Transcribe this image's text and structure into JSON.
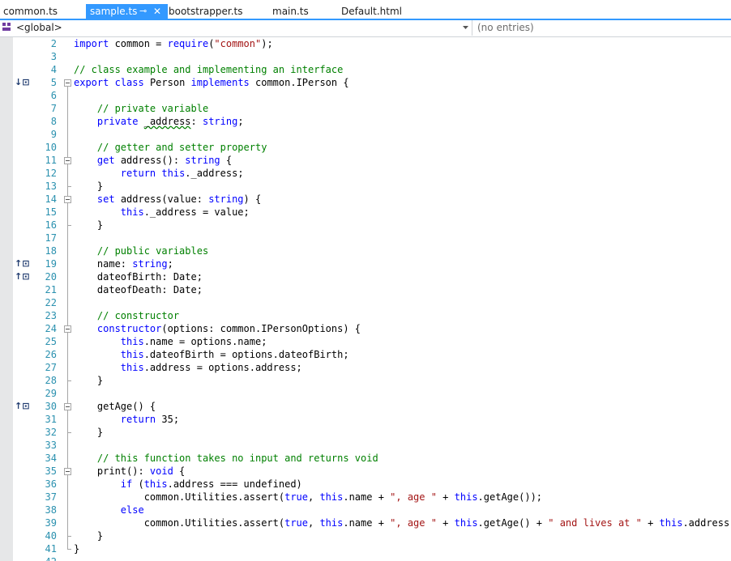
{
  "tabs": [
    {
      "label": "common.ts",
      "active": false
    },
    {
      "label": "sample.ts",
      "active": true,
      "pin": "⊸",
      "close": "✕"
    },
    {
      "label": "bootstrapper.ts",
      "active": false
    },
    {
      "label": "main.ts",
      "active": false
    },
    {
      "label": "Default.html",
      "active": false
    }
  ],
  "nav": {
    "scope": "<global>",
    "members": "(no entries)"
  },
  "colors": {
    "accent": "#3399ff",
    "keyword": "#0000ff",
    "comment": "#008000",
    "string": "#a31515",
    "linenumber": "#2b91af"
  },
  "glyphs": {
    "implements_down": "↓⊡",
    "implements_up": "↑⊡"
  },
  "lines": [
    {
      "n": "2",
      "t": [
        [
          "k",
          "import"
        ],
        [
          "p",
          " common = "
        ],
        [
          "k",
          "require"
        ],
        [
          "p",
          "("
        ],
        [
          "s",
          "\"common\""
        ],
        [
          "p",
          ");"
        ]
      ]
    },
    {
      "n": "3",
      "t": []
    },
    {
      "n": "4",
      "t": [
        [
          "c",
          "// class example and implementing an interface"
        ]
      ]
    },
    {
      "n": "5",
      "t": [
        [
          "k",
          "export"
        ],
        [
          "p",
          " "
        ],
        [
          "k",
          "class"
        ],
        [
          "p",
          " Person "
        ],
        [
          "k",
          "implements"
        ],
        [
          "p",
          " common.IPerson {"
        ]
      ]
    },
    {
      "n": "6",
      "t": []
    },
    {
      "n": "7",
      "t": [
        [
          "p",
          "    "
        ],
        [
          "c",
          "// private variable"
        ]
      ]
    },
    {
      "n": "8",
      "t": [
        [
          "p",
          "    "
        ],
        [
          "k",
          "private"
        ],
        [
          "p",
          " "
        ],
        [
          "sq",
          "_address"
        ],
        [
          "p",
          ": "
        ],
        [
          "k",
          "string"
        ],
        [
          "p",
          ";"
        ]
      ]
    },
    {
      "n": "9",
      "t": []
    },
    {
      "n": "10",
      "t": [
        [
          "p",
          "    "
        ],
        [
          "c",
          "// getter and setter property"
        ]
      ]
    },
    {
      "n": "11",
      "t": [
        [
          "p",
          "    "
        ],
        [
          "k",
          "get"
        ],
        [
          "p",
          " address(): "
        ],
        [
          "k",
          "string"
        ],
        [
          "p",
          " {"
        ]
      ]
    },
    {
      "n": "12",
      "t": [
        [
          "p",
          "        "
        ],
        [
          "k",
          "return"
        ],
        [
          "p",
          " "
        ],
        [
          "k",
          "this"
        ],
        [
          "p",
          "._address;"
        ]
      ]
    },
    {
      "n": "13",
      "t": [
        [
          "p",
          "    }"
        ]
      ]
    },
    {
      "n": "14",
      "t": [
        [
          "p",
          "    "
        ],
        [
          "k",
          "set"
        ],
        [
          "p",
          " address(value: "
        ],
        [
          "k",
          "string"
        ],
        [
          "p",
          ") {"
        ]
      ]
    },
    {
      "n": "15",
      "t": [
        [
          "p",
          "        "
        ],
        [
          "k",
          "this"
        ],
        [
          "p",
          "._address = value;"
        ]
      ]
    },
    {
      "n": "16",
      "t": [
        [
          "p",
          "    }"
        ]
      ]
    },
    {
      "n": "17",
      "t": []
    },
    {
      "n": "18",
      "t": [
        [
          "p",
          "    "
        ],
        [
          "c",
          "// public variables"
        ]
      ]
    },
    {
      "n": "19",
      "t": [
        [
          "p",
          "    name: "
        ],
        [
          "k",
          "string"
        ],
        [
          "p",
          ";"
        ]
      ]
    },
    {
      "n": "20",
      "t": [
        [
          "p",
          "    dateofBirth: Date;"
        ]
      ]
    },
    {
      "n": "21",
      "t": [
        [
          "p",
          "    dateofDeath: Date;"
        ]
      ]
    },
    {
      "n": "22",
      "t": []
    },
    {
      "n": "23",
      "t": [
        [
          "p",
          "    "
        ],
        [
          "c",
          "// constructor"
        ]
      ]
    },
    {
      "n": "24",
      "t": [
        [
          "p",
          "    "
        ],
        [
          "k",
          "constructor"
        ],
        [
          "p",
          "(options: common.IPersonOptions) {"
        ]
      ]
    },
    {
      "n": "25",
      "t": [
        [
          "p",
          "        "
        ],
        [
          "k",
          "this"
        ],
        [
          "p",
          ".name = options.name;"
        ]
      ]
    },
    {
      "n": "26",
      "t": [
        [
          "p",
          "        "
        ],
        [
          "k",
          "this"
        ],
        [
          "p",
          ".dateofBirth = options.dateofBirth;"
        ]
      ]
    },
    {
      "n": "27",
      "t": [
        [
          "p",
          "        "
        ],
        [
          "k",
          "this"
        ],
        [
          "p",
          ".address = options.address;"
        ]
      ]
    },
    {
      "n": "28",
      "t": [
        [
          "p",
          "    }"
        ]
      ]
    },
    {
      "n": "29",
      "t": []
    },
    {
      "n": "30",
      "t": [
        [
          "p",
          "    getAge() {"
        ]
      ]
    },
    {
      "n": "31",
      "t": [
        [
          "p",
          "        "
        ],
        [
          "k",
          "return"
        ],
        [
          "p",
          " 35;"
        ]
      ]
    },
    {
      "n": "32",
      "t": [
        [
          "p",
          "    }"
        ]
      ]
    },
    {
      "n": "33",
      "t": []
    },
    {
      "n": "34",
      "t": [
        [
          "p",
          "    "
        ],
        [
          "c",
          "// this function takes no input and returns void"
        ]
      ]
    },
    {
      "n": "35",
      "t": [
        [
          "p",
          "    print(): "
        ],
        [
          "k",
          "void"
        ],
        [
          "p",
          " {"
        ]
      ]
    },
    {
      "n": "36",
      "t": [
        [
          "p",
          "        "
        ],
        [
          "k",
          "if"
        ],
        [
          "p",
          " ("
        ],
        [
          "k",
          "this"
        ],
        [
          "p",
          ".address === undefined)"
        ]
      ]
    },
    {
      "n": "37",
      "t": [
        [
          "p",
          "            common.Utilities.assert("
        ],
        [
          "k",
          "true"
        ],
        [
          "p",
          ", "
        ],
        [
          "k",
          "this"
        ],
        [
          "p",
          ".name + "
        ],
        [
          "s",
          "\", age \""
        ],
        [
          "p",
          " + "
        ],
        [
          "k",
          "this"
        ],
        [
          "p",
          ".getAge());"
        ]
      ]
    },
    {
      "n": "38",
      "t": [
        [
          "p",
          "        "
        ],
        [
          "k",
          "else"
        ]
      ]
    },
    {
      "n": "39",
      "t": [
        [
          "p",
          "            common.Utilities.assert("
        ],
        [
          "k",
          "true"
        ],
        [
          "p",
          ", "
        ],
        [
          "k",
          "this"
        ],
        [
          "p",
          ".name + "
        ],
        [
          "s",
          "\", age \""
        ],
        [
          "p",
          " + "
        ],
        [
          "k",
          "this"
        ],
        [
          "p",
          ".getAge() + "
        ],
        [
          "s",
          "\" and lives at \""
        ],
        [
          "p",
          " + "
        ],
        [
          "k",
          "this"
        ],
        [
          "p",
          ".address);"
        ]
      ]
    },
    {
      "n": "40",
      "t": [
        [
          "p",
          "    }"
        ]
      ]
    },
    {
      "n": "41",
      "t": [
        [
          "p",
          "}"
        ]
      ]
    },
    {
      "n": "42",
      "t": []
    }
  ]
}
